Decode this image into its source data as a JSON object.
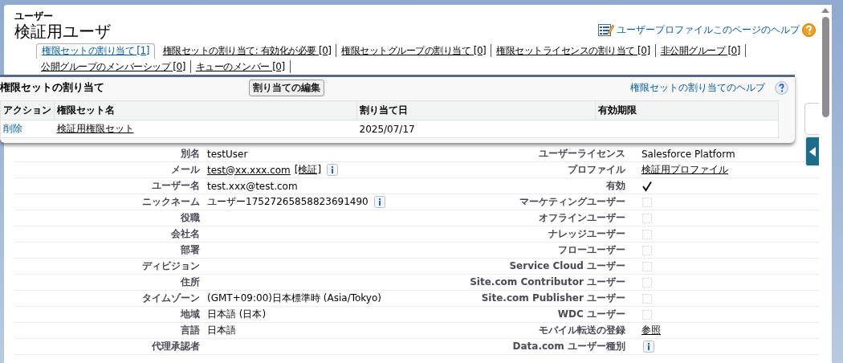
{
  "header": {
    "kicker": "ユーザー",
    "title": "検証用ユーザ",
    "help_link": "ユーザープロファイルこのページのヘルプ"
  },
  "tabs": [
    {
      "label": "権限セットの割り当て",
      "count": "[1]",
      "selected": true
    },
    {
      "label": "権限セットの割り当て: 有効化が必要",
      "count": "[0]",
      "selected": false
    },
    {
      "label": "権限セットグループの割り当て",
      "count": "[0]",
      "selected": false
    },
    {
      "label": "権限セットライセンスの割り当て",
      "count": "[0]",
      "selected": false
    },
    {
      "label": "非公開グループ",
      "count": "[0]",
      "selected": false
    },
    {
      "label": "公開グループのメンバーシップ",
      "count": "[0]",
      "selected": false
    },
    {
      "label": "キューのメンバー",
      "count": "[0]",
      "selected": false
    }
  ],
  "panel": {
    "title": "権限セットの割り当て",
    "button": "割り当ての編集",
    "help_link": "権限セットの割り当てのヘルプ",
    "columns": [
      "アクション",
      "権限セット名",
      "割り当て日",
      "有効期限"
    ],
    "rows": [
      {
        "action": "削除",
        "name": "検証用権限セット",
        "date": "2025/07/17"
      }
    ]
  },
  "fields": [
    {
      "left": {
        "label": "別名",
        "kind": "text",
        "value": "testUser"
      },
      "right": {
        "label": "ユーザーライセンス",
        "kind": "text",
        "value": "Salesforce Platform"
      }
    },
    {
      "left": {
        "label": "メール",
        "kind": "link",
        "value": "test@xx.xxx.com",
        "extra_link": "[検証]",
        "info": true
      },
      "right": {
        "label": "プロファイル",
        "kind": "link",
        "value": "検証用プロファイル"
      }
    },
    {
      "left": {
        "label": "ユーザー名",
        "kind": "text",
        "value": "test.xxx@test.com"
      },
      "right": {
        "label": "有効",
        "kind": "checkbox",
        "checked": true
      }
    },
    {
      "left": {
        "label": "ニックネーム",
        "kind": "text",
        "value": "ユーザー17527265858823691490",
        "info": true
      },
      "right": {
        "label": "マーケティングユーザー",
        "kind": "checkbox",
        "checked": false
      }
    },
    {
      "left": {
        "label": "役職",
        "kind": "text"
      },
      "right": {
        "label": "オフラインユーザー",
        "kind": "checkbox",
        "checked": false
      }
    },
    {
      "left": {
        "label": "会社名",
        "kind": "text"
      },
      "right": {
        "label": "ナレッジユーザー",
        "kind": "checkbox",
        "checked": false
      }
    },
    {
      "left": {
        "label": "部署",
        "kind": "text"
      },
      "right": {
        "label": "フローユーザー",
        "kind": "checkbox",
        "checked": false
      }
    },
    {
      "left": {
        "label": "ディビジョン",
        "kind": "text"
      },
      "right": {
        "label": "Service Cloud ユーザー",
        "kind": "checkbox",
        "checked": false
      }
    },
    {
      "left": {
        "label": "住所",
        "kind": "text"
      },
      "right": {
        "label": "Site.com Contributor ユーザー",
        "kind": "checkbox",
        "checked": false
      }
    },
    {
      "left": {
        "label": "タイムゾーン",
        "kind": "text",
        "value": "(GMT+09:00)日本標準時 (Asia/Tokyo)"
      },
      "right": {
        "label": "Site.com Publisher ユーザー",
        "kind": "checkbox",
        "checked": false
      }
    },
    {
      "left": {
        "label": "地域",
        "kind": "text",
        "value": "日本語 (日本)"
      },
      "right": {
        "label": "WDC ユーザー",
        "kind": "checkbox",
        "checked": false
      }
    },
    {
      "left": {
        "label": "言語",
        "kind": "text",
        "value": "日本語"
      },
      "right": {
        "label": "モバイル転送の登録",
        "kind": "link",
        "value": "参照"
      }
    },
    {
      "left": {
        "label": "代理承認者",
        "kind": "text"
      },
      "right": {
        "label": "Data.com ユーザー種別",
        "kind": "text",
        "info": true
      }
    }
  ]
}
